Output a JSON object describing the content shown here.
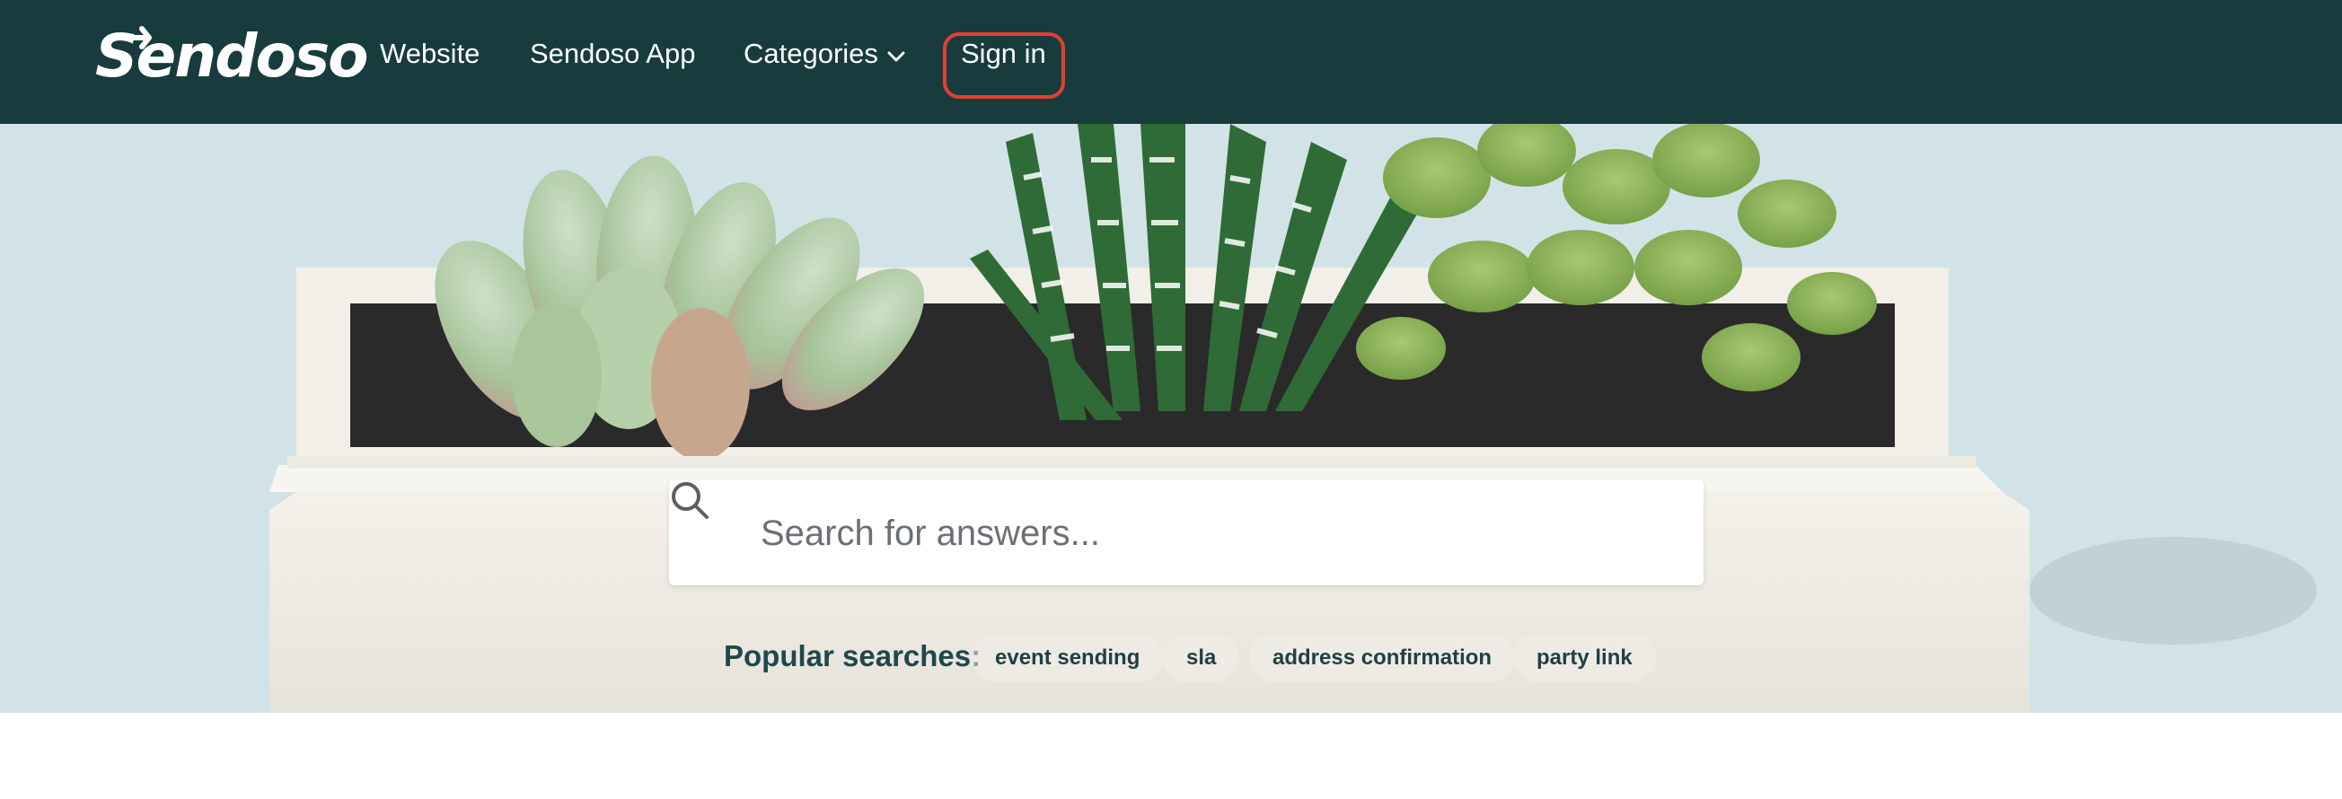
{
  "nav": {
    "logo_text": "Sendoso",
    "links": [
      "Website",
      "Sendoso App",
      "Categories",
      "Sign in"
    ],
    "categories_icon": "chevron-down-icon",
    "brand_bg": "#183c3e",
    "signin_highlight": "#e0412e"
  },
  "search": {
    "placeholder": "Search for answers...",
    "icon": "search-icon"
  },
  "popular": {
    "label": "Popular searches:",
    "items": [
      "event sending",
      "sla",
      "address confirmation",
      "party link"
    ]
  }
}
